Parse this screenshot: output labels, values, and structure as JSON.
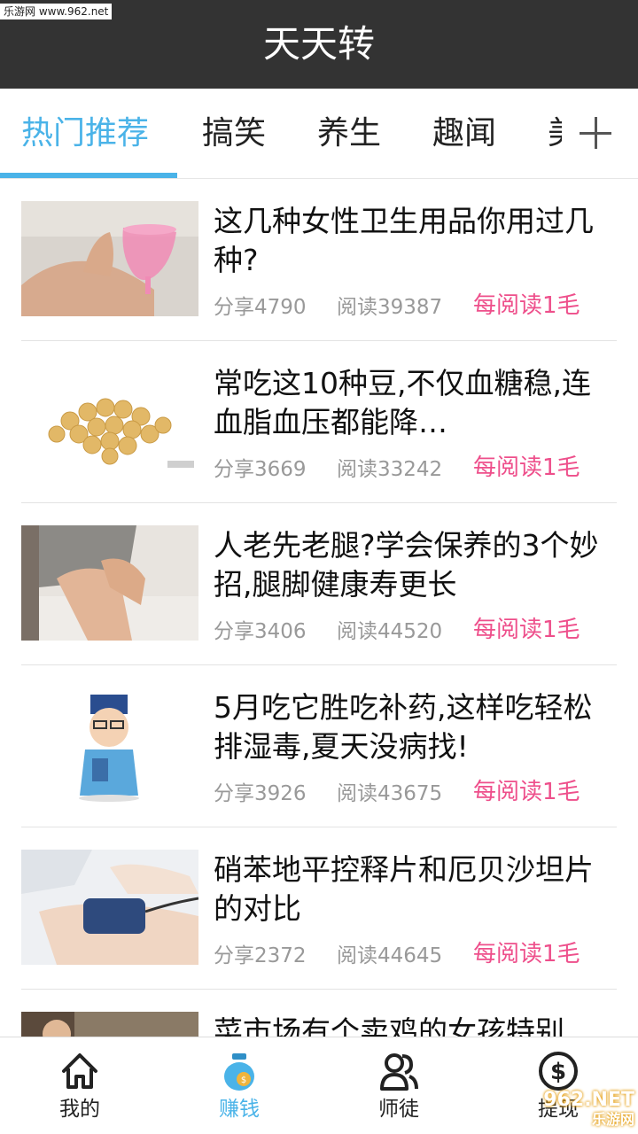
{
  "watermark_top": "乐游网 www.962.net",
  "app": {
    "title": "天天转"
  },
  "tabs": [
    {
      "label": "热门推荐",
      "active": true
    },
    {
      "label": "搞笑",
      "active": false
    },
    {
      "label": "养生",
      "active": false
    },
    {
      "label": "趣闻",
      "active": false
    },
    {
      "label": "美",
      "active": false
    }
  ],
  "articles": [
    {
      "title": "这几种女性卫生用品你用过几种?",
      "share": "分享4790",
      "read": "阅读39387",
      "reward": "每阅读1毛",
      "thumb_icon": "hand-cup-photo"
    },
    {
      "title": "常吃这10种豆,不仅血糖稳,连血脂血压都能降…",
      "share": "分享3669",
      "read": "阅读33242",
      "reward": "每阅读1毛",
      "thumb_icon": "soybeans-photo"
    },
    {
      "title": "人老先老腿?学会保养的3个妙招,腿脚健康寿更长",
      "share": "分享3406",
      "read": "阅读44520",
      "reward": "每阅读1毛",
      "thumb_icon": "knee-photo"
    },
    {
      "title": "5月吃它胜吃补药,这样吃轻松排湿毒,夏天没病找!",
      "share": "分享3926",
      "read": "阅读43675",
      "reward": "每阅读1毛",
      "thumb_icon": "doctor-cartoon"
    },
    {
      "title": "硝苯地平控释片和厄贝沙坦片的对比",
      "share": "分享2372",
      "read": "阅读44645",
      "reward": "每阅读1毛",
      "thumb_icon": "blood-pressure-photo"
    },
    {
      "title": "菜市场有个卖鸡的女孩特别",
      "share": "",
      "read": "",
      "reward": "",
      "thumb_icon": "market-photo"
    }
  ],
  "bottom_nav": [
    {
      "label": "我的",
      "icon": "home-icon",
      "active": false
    },
    {
      "label": "赚钱",
      "icon": "money-bag-icon",
      "active": true
    },
    {
      "label": "师徒",
      "icon": "people-icon",
      "active": false
    },
    {
      "label": "提现",
      "icon": "dollar-coin-icon",
      "active": false
    }
  ],
  "watermark_bottom": {
    "logo": "962.NET",
    "sub": "乐游网"
  },
  "colors": {
    "accent": "#4ab3e8",
    "reward": "#ee4f8b",
    "titlebar": "#333333"
  }
}
